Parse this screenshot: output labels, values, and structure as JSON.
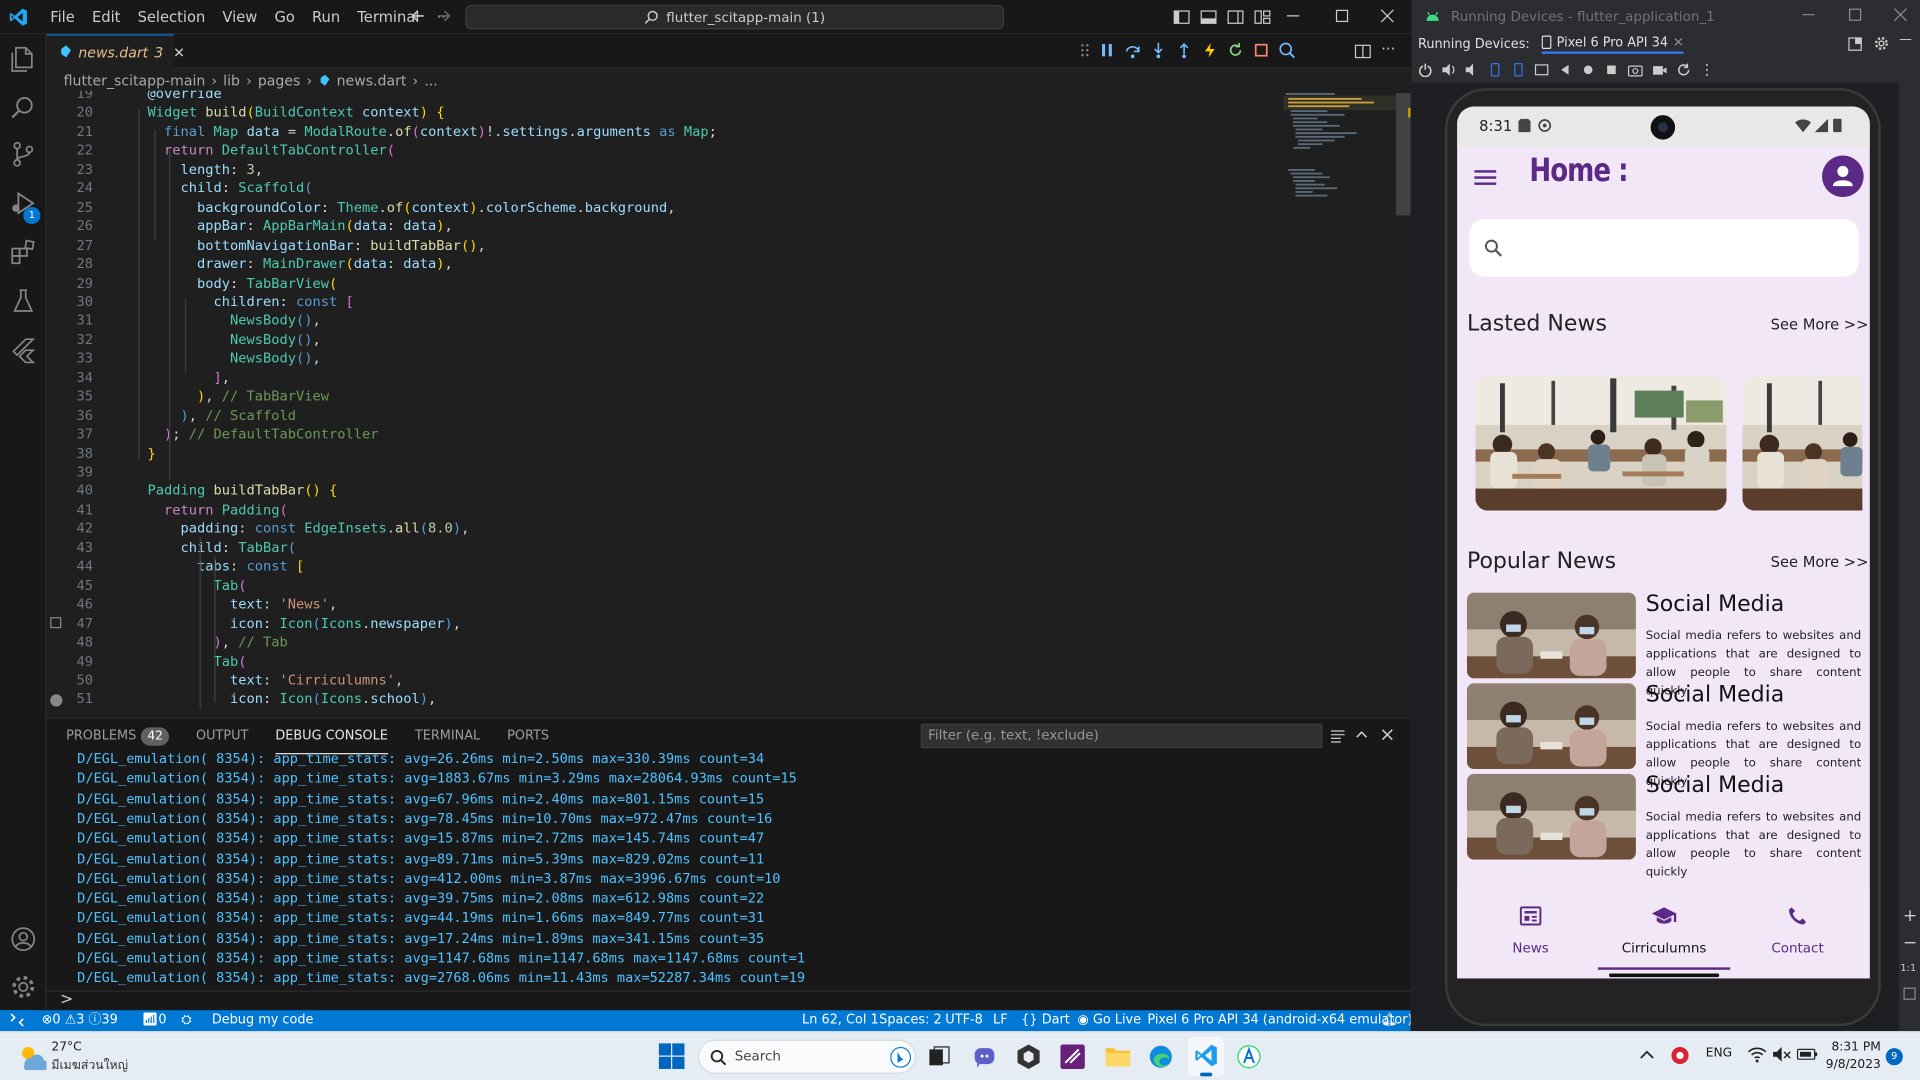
{
  "vscode": {
    "menus": [
      "File",
      "Edit",
      "Selection",
      "View",
      "Go",
      "Run",
      "Terminal",
      "···"
    ],
    "search_text": "flutter_scitapp-main (1)",
    "tab": {
      "label": "news.dart",
      "badge": "3"
    },
    "breadcrumb": [
      "flutter_scitapp-main",
      "lib",
      "pages",
      "news.dart",
      "..."
    ],
    "code_lines": [
      {
        "n": "19",
        "html": "  <span class='v'>@override</span>"
      },
      {
        "n": "20",
        "html": "  <span class='t'>Widget</span> <span class='f'>build</span><span class='y'>(</span><span class='t'>BuildContext</span> <span class='v'>context</span><span class='y'>)</span> <span class='y'>{</span>"
      },
      {
        "n": "21",
        "html": "    <span class='k'>final</span> <span class='t'>Map</span> <span class='v'>data</span> = <span class='t'>ModalRoute</span>.<span class='f'>of</span><span class='pk'>(</span><span class='v'>context</span><span class='pk'>)</span>!.<span class='v'>settings</span>.<span class='v'>arguments</span> <span class='k'>as</span> <span class='t'>Map</span>;"
      },
      {
        "n": "22",
        "html": "    <span class='kc'>return</span> <span class='t'>DefaultTabController</span><span class='pk'>(</span>"
      },
      {
        "n": "23",
        "html": "      <span class='v'>length</span>: <span class='n'>3</span>,"
      },
      {
        "n": "24",
        "html": "      <span class='v'>child</span>: <span class='t'>Scaffold</span><span class='k'>(</span>"
      },
      {
        "n": "25",
        "html": "        <span class='v'>backgroundColor</span>: <span class='t'>Theme</span>.<span class='f'>of</span><span class='y'>(</span><span class='v'>context</span><span class='y'>)</span>.<span class='v'>colorScheme</span>.<span class='v'>background</span>,"
      },
      {
        "n": "26",
        "html": "        <span class='v'>appBar</span>: <span class='t'>AppBarMain</span><span class='y'>(</span><span class='v'>data</span>: <span class='v'>data</span><span class='y'>)</span>,"
      },
      {
        "n": "27",
        "html": "        <span class='v'>bottomNavigationBar</span>: <span class='f'>buildTabBar</span><span class='y'>()</span>,"
      },
      {
        "n": "28",
        "html": "        <span class='v'>drawer</span>: <span class='t'>MainDrawer</span><span class='y'>(</span><span class='v'>data</span>: <span class='v'>data</span><span class='y'>)</span>,"
      },
      {
        "n": "29",
        "html": "        <span class='v'>body</span>: <span class='t'>TabBarView</span><span class='y'>(</span>"
      },
      {
        "n": "30",
        "html": "          <span class='v'>children</span>: <span class='k'>const</span> <span class='pk'>[</span>"
      },
      {
        "n": "31",
        "html": "            <span class='t'>NewsBody</span><span class='k'>()</span>,"
      },
      {
        "n": "32",
        "html": "            <span class='t'>NewsBody</span><span class='k'>()</span>,"
      },
      {
        "n": "33",
        "html": "            <span class='t'>NewsBody</span><span class='k'>()</span>,"
      },
      {
        "n": "34",
        "html": "          <span class='pk'>]</span>,"
      },
      {
        "n": "35",
        "html": "        <span class='y'>)</span>, <span class='c'>// TabBarView</span>"
      },
      {
        "n": "36",
        "html": "      <span class='k'>)</span>, <span class='c'>// Scaffold</span>"
      },
      {
        "n": "37",
        "html": "    <span class='pk'>)</span>; <span class='c'>// DefaultTabController</span>"
      },
      {
        "n": "38",
        "html": "  <span class='y'>}</span>"
      },
      {
        "n": "39",
        "html": ""
      },
      {
        "n": "40",
        "html": "  <span class='t'>Padding</span> <span class='f'>buildTabBar</span><span class='y'>()</span> <span class='y'>{</span>"
      },
      {
        "n": "41",
        "html": "    <span class='kc'>return</span> <span class='t'>Padding</span><span class='pk'>(</span>"
      },
      {
        "n": "42",
        "html": "      <span class='v'>padding</span>: <span class='k'>const</span> <span class='t'>EdgeInsets</span>.<span class='f'>all</span><span class='k'>(</span><span class='n'>8.0</span><span class='k'>)</span>,"
      },
      {
        "n": "43",
        "html": "      <span class='v'>child</span>: <span class='t'>TabBar</span><span class='k'>(</span>"
      },
      {
        "n": "44",
        "html": "        <span class='v'>tabs</span>: <span class='k'>const</span> <span class='y'>[</span>"
      },
      {
        "n": "45",
        "html": "          <span class='t'>Tab</span><span class='pk'>(</span>"
      },
      {
        "n": "46",
        "html": "            <span class='v'>text</span>: <span class='s'>'News'</span>,"
      },
      {
        "n": "47",
        "html": "            <span class='v'>icon</span>: <span class='t'>Icon</span><span class='k'>(</span><span class='t'>Icons</span>.<span class='v'>newspaper</span><span class='k'>)</span>,"
      },
      {
        "n": "48",
        "html": "          <span class='pk'>)</span>, <span class='c'>// Tab</span>"
      },
      {
        "n": "49",
        "html": "          <span class='t'>Tab</span><span class='pk'>(</span>"
      },
      {
        "n": "50",
        "html": "            <span class='v'>text</span>: <span class='s'>'Cirriculumns'</span>,"
      },
      {
        "n": "51",
        "html": "            <span class='v'>icon</span>: <span class='t'>Icon</span><span class='k'>(</span><span class='t'>Icons</span>.<span class='v'>school</span><span class='k'>)</span>,"
      }
    ],
    "panel": {
      "tabs": [
        "Problems",
        "Output",
        "Debug Console",
        "Terminal",
        "Ports"
      ],
      "problems_count": "42",
      "filter_placeholder": "Filter (e.g. text, !exclude)",
      "console_lines": [
        "D/EGL_emulation( 8354): app_time_stats: avg=26.26ms min=2.50ms max=330.39ms count=34",
        "D/EGL_emulation( 8354): app_time_stats: avg=1883.67ms min=3.29ms max=28064.93ms count=15",
        "D/EGL_emulation( 8354): app_time_stats: avg=67.96ms min=2.40ms max=801.15ms count=15",
        "D/EGL_emulation( 8354): app_time_stats: avg=78.45ms min=10.70ms max=972.47ms count=16",
        "D/EGL_emulation( 8354): app_time_stats: avg=15.87ms min=2.72ms max=145.74ms count=47",
        "D/EGL_emulation( 8354): app_time_stats: avg=89.71ms min=5.39ms max=829.02ms count=11",
        "D/EGL_emulation( 8354): app_time_stats: avg=412.00ms min=3.87ms max=3996.67ms count=10",
        "D/EGL_emulation( 8354): app_time_stats: avg=39.75ms min=2.08ms max=612.98ms count=22",
        "D/EGL_emulation( 8354): app_time_stats: avg=44.19ms min=1.66ms max=849.77ms count=31",
        "D/EGL_emulation( 8354): app_time_stats: avg=17.24ms min=1.89ms max=341.15ms count=35",
        "D/EGL_emulation( 8354): app_time_stats: avg=1147.68ms min=1147.68ms max=1147.68ms count=1",
        "D/EGL_emulation( 8354): app_time_stats: avg=2768.06ms min=11.43ms max=52287.34ms count=19"
      ],
      "prompt": ">"
    },
    "status": {
      "errors": "0",
      "warnings": "3",
      "info": "39",
      "ports": "0",
      "debug": "Debug my code",
      "position": "Ln 62, Col 1",
      "spaces": "Spaces: 2",
      "encoding": "UTF-8",
      "eol": "LF",
      "language": "Dart",
      "golive": "Go Live",
      "device": "Pixel 6 Pro API 34 (android-x64 emulator)"
    },
    "activity_badge": "1"
  },
  "android_studio": {
    "title": "Running Devices - flutter_application_1",
    "label": "Running Devices:",
    "device_tab": "Pixel 6 Pro API 34",
    "zoom": "1:1"
  },
  "phone": {
    "time": "8:31",
    "app_title": "Home :",
    "search_placeholder": "",
    "latest_title": "Lasted News",
    "see_more_1": "See More  >>",
    "popular_title": "Popular News",
    "see_more_2": "See More  >>",
    "news": [
      {
        "title": "Social Media",
        "body": "Social media refers to websites and applications that are designed to allow people to share content quickly"
      },
      {
        "title": "Social Media",
        "body": "Social media refers to websites and applications that are designed to allow people to share content quickly"
      },
      {
        "title": "Social Media",
        "body": "Social media refers to websites and applications that are designed to allow people to share content quickly"
      }
    ],
    "nav": [
      {
        "label": "News",
        "active": false
      },
      {
        "label": "Cirriculumns",
        "active": true
      },
      {
        "label": "Contact",
        "active": false
      }
    ],
    "accent": "#5b2a86"
  },
  "taskbar": {
    "weather_temp": "27°C",
    "weather_text": "มีเมฆส่วนใหญ่",
    "search": "Search",
    "lang": "ENG",
    "time": "8:31 PM",
    "date": "9/8/2023",
    "notif_badge": "9"
  }
}
